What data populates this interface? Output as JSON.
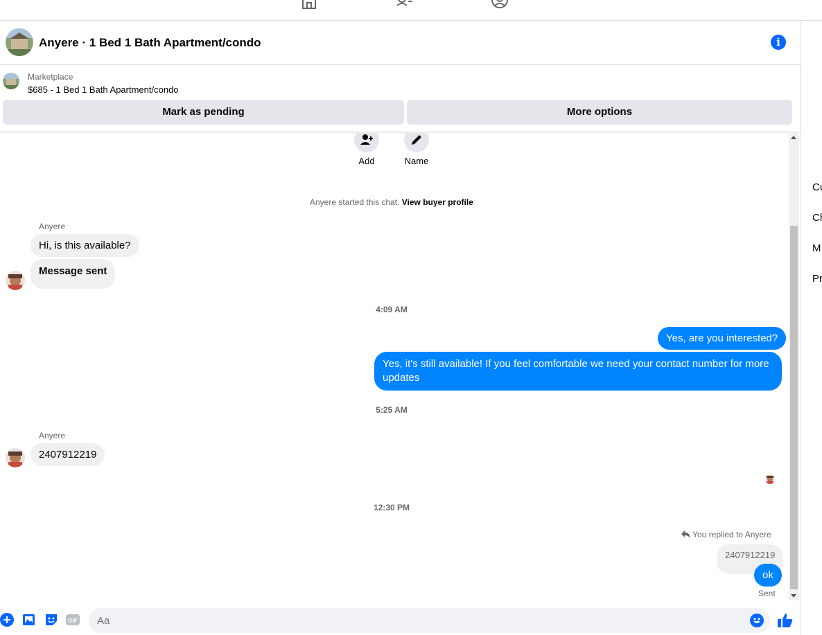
{
  "topnav": {
    "icons": [
      "home-icon",
      "friends-icon",
      "profile-icon"
    ]
  },
  "header": {
    "title": "Anyere · 1 Bed 1 Bath Apartment/condo",
    "info_icon": "i"
  },
  "marketplace": {
    "label": "Marketplace",
    "listing": "$685 - 1 Bed 1 Bath Apartment/condo",
    "mark_pending": "Mark as pending",
    "more_options": "More options"
  },
  "actions": {
    "add_label": "Add",
    "name_label": "Name"
  },
  "chat_start": {
    "text": "Anyere started this chat.",
    "link": "View buyer profile"
  },
  "messages": {
    "sender1": "Anyere",
    "msg1": "Hi, is this available?",
    "msg2": "Message sent",
    "time1": "4:09 AM",
    "out1": "Yes, are you interested?",
    "out2": "Yes, it's still available! If you feel comfortable  we need your contact number for more updates",
    "time2": "5:25 AM",
    "sender2": "Anyere",
    "msg3": "2407912219",
    "time3": "12:30 PM",
    "reply_note": "You replied to Anyere",
    "reply_quote": "2407912219",
    "out3": "ok",
    "status": "Sent"
  },
  "composer": {
    "placeholder": "Aa",
    "gif": "GIF"
  },
  "right_column": {
    "items": [
      "Cu",
      "Ch",
      "M",
      "Pr"
    ]
  },
  "colors": {
    "accent": "#0084ff",
    "info_blue": "#0866ff",
    "bubble_in": "#f0f0f0",
    "button_bg": "#e4e6eb"
  }
}
